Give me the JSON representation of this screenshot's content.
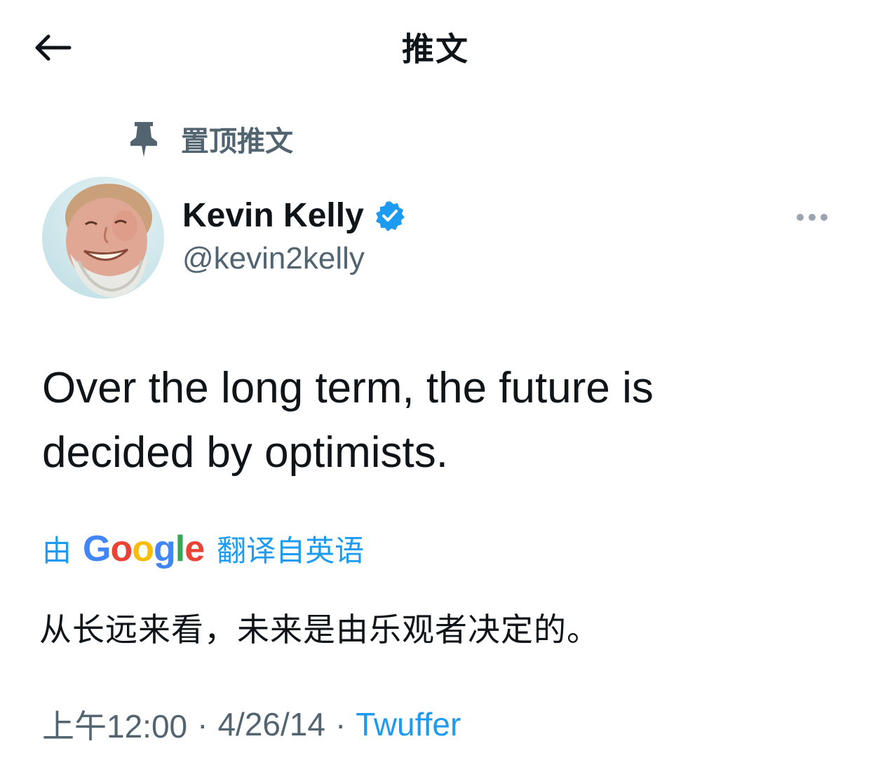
{
  "header": {
    "title": "推文"
  },
  "pinned": {
    "label": "置顶推文"
  },
  "author": {
    "name": "Kevin Kelly",
    "handle": "@kevin2kelly"
  },
  "tweet": {
    "text_line1": "Over the long term, the future is",
    "text_line2": "decided by optimists."
  },
  "translation": {
    "prefix": "由",
    "logo_text": "Google",
    "suffix": "翻译自英语",
    "text": "从长远来看，未来是由乐观者决定的。"
  },
  "meta": {
    "time": "上午12:00",
    "separator": "·",
    "date": "4/26/14",
    "source": "Twuffer"
  },
  "colors": {
    "accent": "#1d9bf0",
    "secondary_text": "#536471",
    "primary_text": "#0f1419"
  },
  "icons": {
    "back": "arrow-left-icon",
    "pin": "pin-icon",
    "verified": "verified-badge-icon",
    "more": "more-horizontal-icon"
  }
}
